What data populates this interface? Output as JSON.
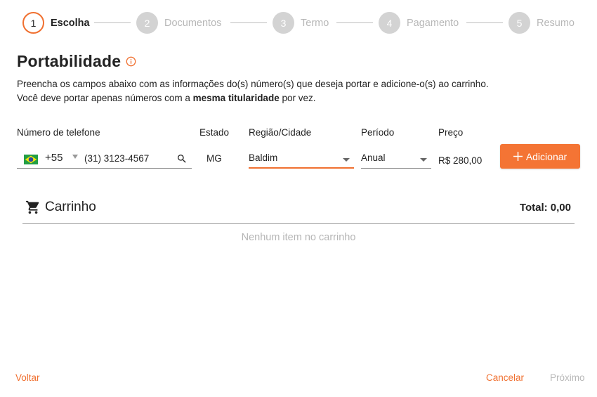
{
  "stepper": {
    "steps": [
      {
        "number": "1",
        "label": "Escolha",
        "state": "active"
      },
      {
        "number": "2",
        "label": "Documentos",
        "state": "inactive"
      },
      {
        "number": "3",
        "label": "Termo",
        "state": "inactive"
      },
      {
        "number": "4",
        "label": "Pagamento",
        "state": "inactive"
      },
      {
        "number": "5",
        "label": "Resumo",
        "state": "inactive"
      }
    ]
  },
  "header": {
    "title": "Portabilidade",
    "info_icon": "info-circle-icon",
    "desc_line1": "Preencha os campos abaixo com as informações do(s) número(s) que deseja portar e adicione-o(s) ao carrinho.",
    "desc_line2_pre": "Você deve portar apenas números com a ",
    "desc_line2_bold": "mesma titularidade",
    "desc_line2_post": " por vez."
  },
  "form": {
    "phone_label": "Número de telefone",
    "ddi": "+55",
    "flag_icon": "brazil-flag-icon",
    "phone_value": "(31) 3123-4567",
    "estado_label": "Estado",
    "estado_value": "MG",
    "regiao_label": "Região/Cidade",
    "regiao_value": "Baldim",
    "periodo_label": "Período",
    "periodo_value": "Anual",
    "preco_label": "Preço",
    "preco_value": "R$ 280,00",
    "add_button": "Adicionar"
  },
  "cart": {
    "title": "Carrinho",
    "total": "Total: 0,00",
    "empty_message": "Nenhum item no carrinho"
  },
  "footer": {
    "back": "Voltar",
    "cancel": "Cancelar",
    "next": "Próximo"
  },
  "colors": {
    "accent": "#f47434",
    "inactive_step": "#d3d3d3",
    "muted_text": "#b5b5b5"
  }
}
